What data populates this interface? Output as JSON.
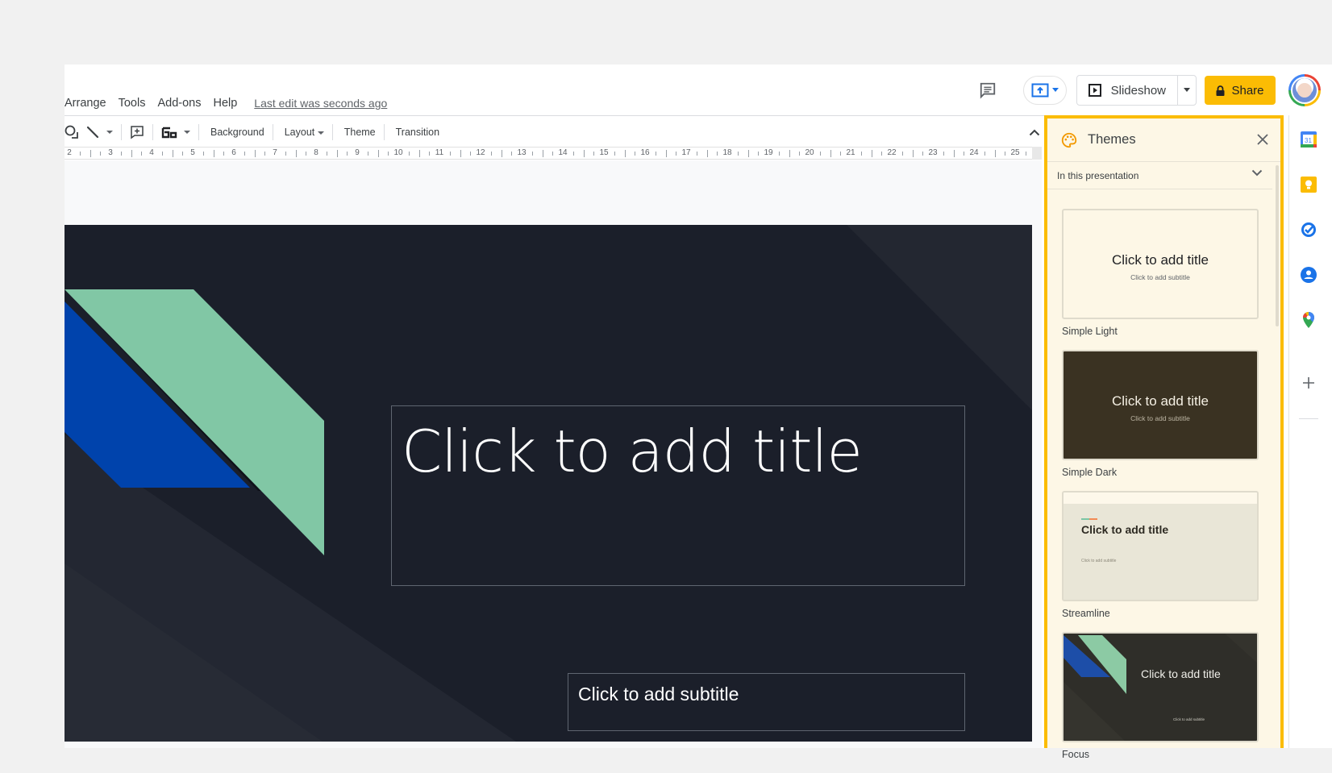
{
  "menu": {
    "items": [
      "Arrange",
      "Tools",
      "Add-ons",
      "Help"
    ],
    "last_edit": "Last edit was seconds ago"
  },
  "header": {
    "comments_icon": "comment-history-icon",
    "present_icon": "present-to-meeting-icon",
    "slideshow_label": "Slideshow",
    "share_label": "Share",
    "share_icon": "lock-icon",
    "avatar": "user-avatar"
  },
  "toolbar": {
    "icons": [
      "shape-icon",
      "line-icon",
      "comment-add-icon",
      "layout-format-icon"
    ],
    "background_label": "Background",
    "layout_label": "Layout",
    "theme_label": "Theme",
    "transition_label": "Transition"
  },
  "ruler": {
    "labels": [
      "2",
      "3",
      "4",
      "5",
      "6",
      "7",
      "8",
      "9",
      "10",
      "11",
      "12",
      "13",
      "14",
      "15",
      "16",
      "17",
      "18",
      "19",
      "20",
      "21",
      "22",
      "23",
      "24",
      "25"
    ]
  },
  "slide": {
    "title_placeholder": "Click to add title",
    "subtitle_placeholder": "Click to add subtitle",
    "colors": {
      "background": "#1b1f2a",
      "green": "#81c7a5",
      "blue": "#0043ac"
    }
  },
  "themes_panel": {
    "title": "Themes",
    "filter_label": "In this presentation",
    "accent": "#fbbc04",
    "themes": [
      {
        "name": "Simple Light",
        "title": "Click to add title",
        "subtitle": "Click to add subtitle"
      },
      {
        "name": "Simple Dark",
        "title": "Click to add title",
        "subtitle": "Click to add subtitle"
      },
      {
        "name": "Streamline",
        "title": "Click to add title",
        "subtitle": "Click to add subtitle"
      },
      {
        "name": "Focus",
        "title": "Click to add title",
        "subtitle": "Click to add subtitle"
      }
    ]
  },
  "side_panel": {
    "icons": [
      "calendar-icon",
      "keep-icon",
      "tasks-icon",
      "contacts-icon",
      "maps-icon",
      "add-icon"
    ],
    "calendar_day": "31"
  }
}
